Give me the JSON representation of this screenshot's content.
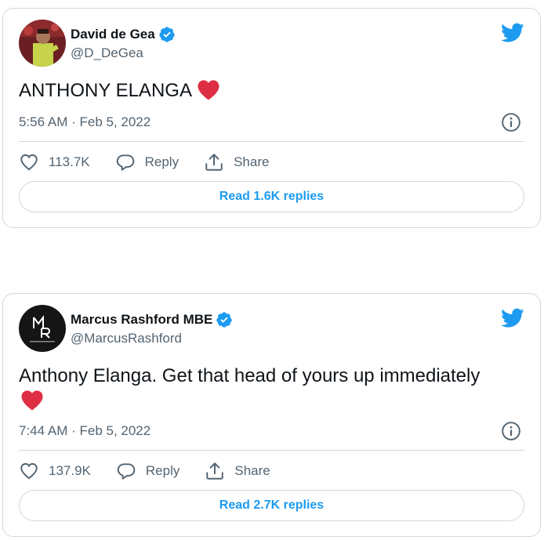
{
  "colors": {
    "accent": "#1d9bf0",
    "heart": "#dd2e44",
    "secondary_text": "#536471",
    "border": "#cfd9de"
  },
  "tweets": [
    {
      "display_name": "David de Gea",
      "handle": "@D_DeGea",
      "verified": true,
      "text": "ANTHONY ELANGA",
      "emoji": "red-heart",
      "timestamp": "5:56 AM · Feb 5, 2022",
      "likes": "113.7K",
      "reply_label": "Reply",
      "share_label": "Share",
      "read_replies": "Read 1.6K replies"
    },
    {
      "display_name": "Marcus Rashford MBE",
      "handle": "@MarcusRashford",
      "verified": true,
      "text": "Anthony Elanga. Get that head of yours up immediately",
      "emoji": "red-heart",
      "timestamp": "7:44 AM · Feb 5, 2022",
      "likes": "137.9K",
      "reply_label": "Reply",
      "share_label": "Share",
      "read_replies": "Read 2.7K replies"
    }
  ]
}
